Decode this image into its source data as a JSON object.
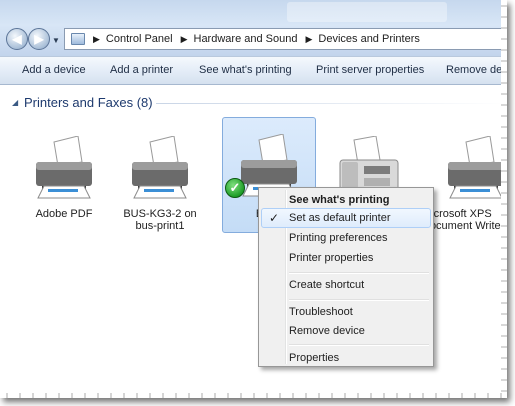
{
  "address_bar": {
    "crumbs": [
      "Control Panel",
      "Hardware and Sound",
      "Devices and Printers"
    ]
  },
  "toolbar": {
    "add_device": "Add a device",
    "add_printer": "Add a printer",
    "see_printing": "See what's printing",
    "print_server": "Print server properties",
    "remove_device": "Remove device"
  },
  "group": {
    "title": "Printers and Faxes (8)"
  },
  "devices": [
    {
      "line1": "Adobe PDF",
      "line2": ""
    },
    {
      "line1": "BUS-KG3-2 on",
      "line2": "bus-print1"
    },
    {
      "line1": "BUS-",
      "line2": "bu"
    },
    {
      "line1": "",
      "line2": ""
    },
    {
      "line1": "Microsoft XPS",
      "line2": "Document Writer"
    }
  ],
  "context_menu": {
    "items": [
      {
        "label": "See what's printing"
      },
      {
        "label": "Set as default printer",
        "check": "✓"
      },
      {
        "label": "Printing preferences"
      },
      {
        "label": "Printer properties"
      },
      {
        "label": "Create shortcut"
      },
      {
        "label": "Troubleshoot"
      },
      {
        "label": "Remove device"
      },
      {
        "label": "Properties"
      }
    ]
  },
  "icons": {
    "back": "back-arrow-icon",
    "forward": "forward-arrow-icon",
    "default_check": "default-check-icon"
  },
  "colors": {
    "accent": "#1e3a6e",
    "selection": "#c4dcf6",
    "menu_hover": "#dfecfc"
  }
}
